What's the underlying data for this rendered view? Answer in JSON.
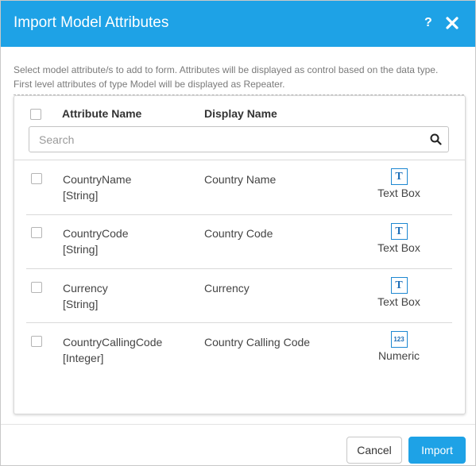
{
  "dialog": {
    "title": "Import Model Attributes",
    "help_label": "?",
    "description_line1": "Select model attribute/s to add to form. Attributes will be displayed as control based on the data type.",
    "description_line2": "First level attributes of type Model will be displayed as Repeater."
  },
  "table": {
    "col_attribute": "Attribute Name",
    "col_display": "Display Name",
    "search_placeholder": "Search",
    "rows": [
      {
        "name": "CountryName",
        "type": "[String]",
        "display": "Country Name",
        "control_icon": "T",
        "control": "Text Box"
      },
      {
        "name": "CountryCode",
        "type": "[String]",
        "display": "Country Code",
        "control_icon": "T",
        "control": "Text Box"
      },
      {
        "name": "Currency",
        "type": "[String]",
        "display": "Currency",
        "control_icon": "T",
        "control": "Text Box"
      },
      {
        "name": "CountryCallingCode",
        "type": "[Integer]",
        "display": "Country Calling Code",
        "control_icon": "123",
        "control": "Numeric"
      }
    ]
  },
  "footer": {
    "cancel_label": "Cancel",
    "import_label": "Import"
  },
  "colors": {
    "accent": "#1ea2e6",
    "icon_blue": "#1e88d2"
  }
}
